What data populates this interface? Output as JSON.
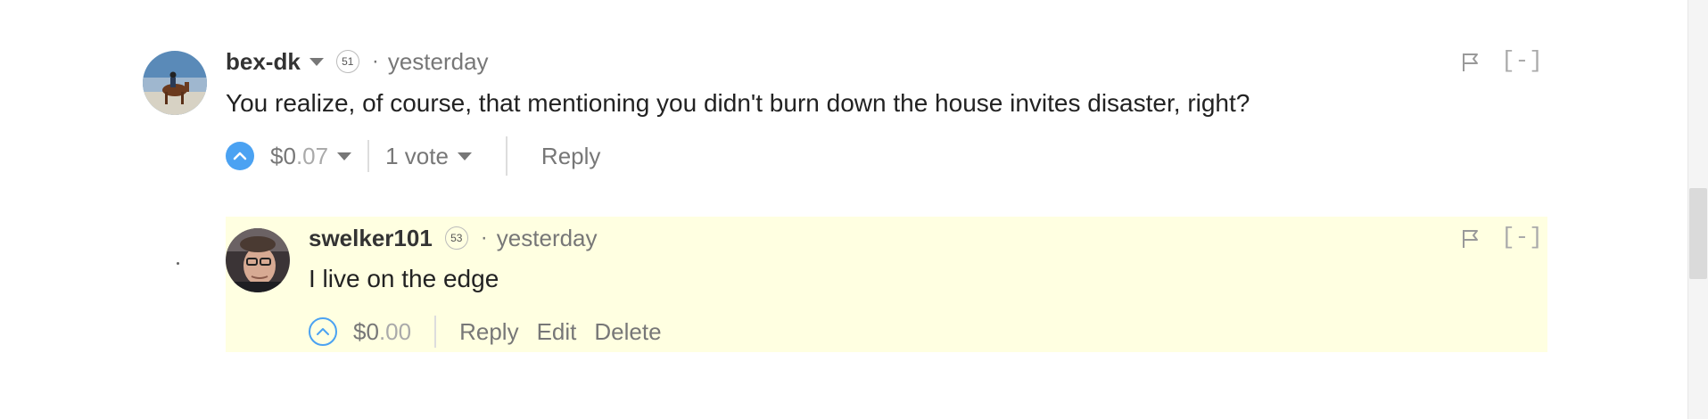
{
  "comments": [
    {
      "author": "bex-dk",
      "reputation": "51",
      "separator": "·",
      "timestamp": "yesterday",
      "body": "You realize, of course, that mentioning you didn't burn down the house invites disaster, right?",
      "payout_prefix": "$",
      "payout_whole": "0",
      "payout_cents": ".07",
      "votes": "1 vote",
      "actions": [
        "Reply"
      ],
      "collapse": "[-]"
    },
    {
      "author": "swelker101",
      "reputation": "53",
      "separator": "·",
      "timestamp": "yesterday",
      "body": "I live on the edge",
      "payout_prefix": "$",
      "payout_whole": "0",
      "payout_cents": ".00",
      "actions": [
        "Reply",
        "Edit",
        "Delete"
      ],
      "collapse": "[-]"
    }
  ],
  "colors": {
    "accent": "#4ba2f2",
    "highlight_background": "#ffffe1"
  }
}
